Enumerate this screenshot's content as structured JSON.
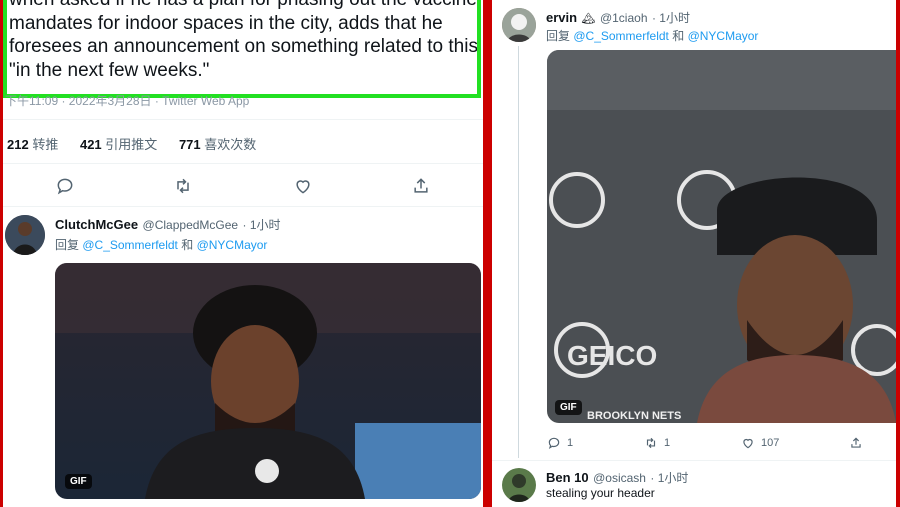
{
  "left": {
    "top_tweet": {
      "text": "when asked if he has a plan for phasing out the vaccine mandates for indoor spaces in the city, adds that he foresees an announcement on something related to this \"in the next few weeks.\"",
      "meta": "下午11:09 · 2022年3月28日 · Twitter Web App"
    },
    "stats": [
      {
        "value": "212",
        "label": "转推"
      },
      {
        "value": "421",
        "label": "引用推文"
      },
      {
        "value": "771",
        "label": "喜欢次数"
      }
    ],
    "actions": [
      "reply-icon",
      "retweet-icon",
      "like-icon",
      "share-icon"
    ],
    "reply": {
      "name": "ClutchMcGee",
      "handle": "@ClappedMcGee",
      "time": "· 1小时",
      "reply_prefix": "回复 ",
      "mention1": "@C_Sommerfeldt",
      "conj": " 和 ",
      "mention2": "@NYCMayor",
      "gif_label": "GIF"
    }
  },
  "right": {
    "reply1": {
      "name": "ervin",
      "emoji": "🏔",
      "handle": "@1ciaoh",
      "time": "· 1小时",
      "reply_prefix": "回复 ",
      "mention1": "@C_Sommerfeldt",
      "conj": " 和 ",
      "mention2": "@NYCMayor",
      "gif_label": "GIF",
      "backdrop_text": "GEICO",
      "caption": "BROOKLYN NETS",
      "reply_count": "1",
      "retweet_count": "1",
      "like_count": "107"
    },
    "reply2": {
      "name": "Ben 10",
      "handle": "@osicash",
      "time": "· 1小时",
      "text": "stealing your header"
    }
  },
  "colors": {
    "frame": "#cc0000",
    "highlight": "#22e022",
    "link": "#1d9bf0",
    "muted": "#536471"
  }
}
